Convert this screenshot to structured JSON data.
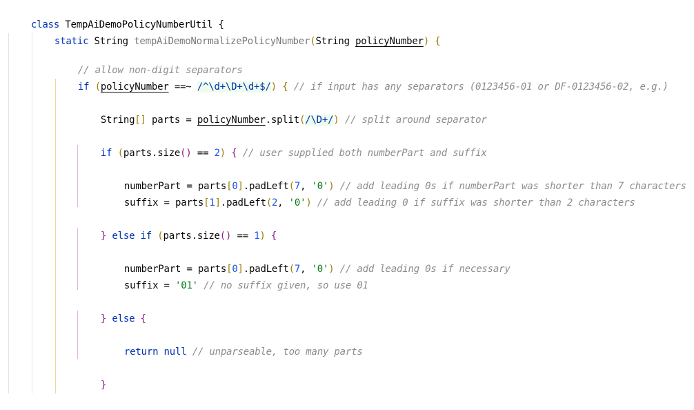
{
  "editor": {
    "language": "groovy",
    "lines": [
      {
        "class_kw": "class",
        "class_name": "TempAiDemoPolicyNumberUtil",
        "brace": "{"
      },
      {
        "static_kw": "static",
        "ret_type": "String",
        "method_name": "tempAiDemoNormalizePolicyNumber",
        "open_paren": "(",
        "param_type": "String",
        "param_name": "policyNumber",
        "close_paren": ")",
        "brace": "{"
      },
      {
        "comment": "// allow non-digit separators"
      },
      {
        "if_kw": "if",
        "open_paren": "(",
        "var": "policyNumber",
        "op": "==~",
        "regex": "/^\\d+\\D+\\d+$/",
        "close_paren": ")",
        "brace": "{",
        "comment": "// if input has any separators (0123456-01 or DF-0123456-02, e.g.)"
      },
      {
        "type": "String",
        "brackets": "[]",
        "name": "parts",
        "eq": "=",
        "var": "policyNumber",
        "call": ".split",
        "open_paren": "(",
        "regex": "/\\D+/",
        "close_paren": ")",
        "comment": "// split around separator"
      },
      {
        "if_kw": "if",
        "open_paren": "(",
        "expr": "parts.size",
        "call_parens": "()",
        "op": "==",
        "num": "2",
        "close_paren": ")",
        "brace": "{",
        "comment": "// user supplied both numberPart and suffix"
      },
      {
        "lhs": "numberPart",
        "eq": "=",
        "obj": "parts",
        "lb": "[",
        "idx": "0",
        "rb": "]",
        "call": ".padLeft",
        "open_paren": "(",
        "arg1": "7",
        "comma": ",",
        "arg2": "'0'",
        "close_paren": ")",
        "comment": "// add leading 0s if numberPart was shorter than 7 characters"
      },
      {
        "lhs": "suffix",
        "eq": "=",
        "obj": "parts",
        "lb": "[",
        "idx": "1",
        "rb": "]",
        "call": ".padLeft",
        "open_paren": "(",
        "arg1": "2",
        "comma": ",",
        "arg2": "'0'",
        "close_paren": ")",
        "comment": "// add leading 0 if suffix was shorter than 2 characters"
      },
      {
        "close_brace": "}",
        "else_kw": "else",
        "if_kw": "if",
        "open_paren": "(",
        "expr": "parts.size",
        "call_parens": "()",
        "op": "==",
        "num": "1",
        "close_paren": ")",
        "brace": "{"
      },
      {
        "lhs": "numberPart",
        "eq": "=",
        "obj": "parts",
        "lb": "[",
        "idx": "0",
        "rb": "]",
        "call": ".padLeft",
        "open_paren": "(",
        "arg1": "7",
        "comma": ",",
        "arg2": "'0'",
        "close_paren": ")",
        "comment": "// add leading 0s if necessary"
      },
      {
        "lhs": "suffix",
        "eq": "=",
        "str": "'01'",
        "comment": "// no suffix given, so use 01"
      },
      {
        "close_brace": "}",
        "else_kw": "else",
        "brace": "{"
      },
      {
        "return_kw": "return",
        "null_kw": "null",
        "comment": "// unparseable, too many parts"
      },
      {
        "close_brace": "}"
      }
    ]
  }
}
